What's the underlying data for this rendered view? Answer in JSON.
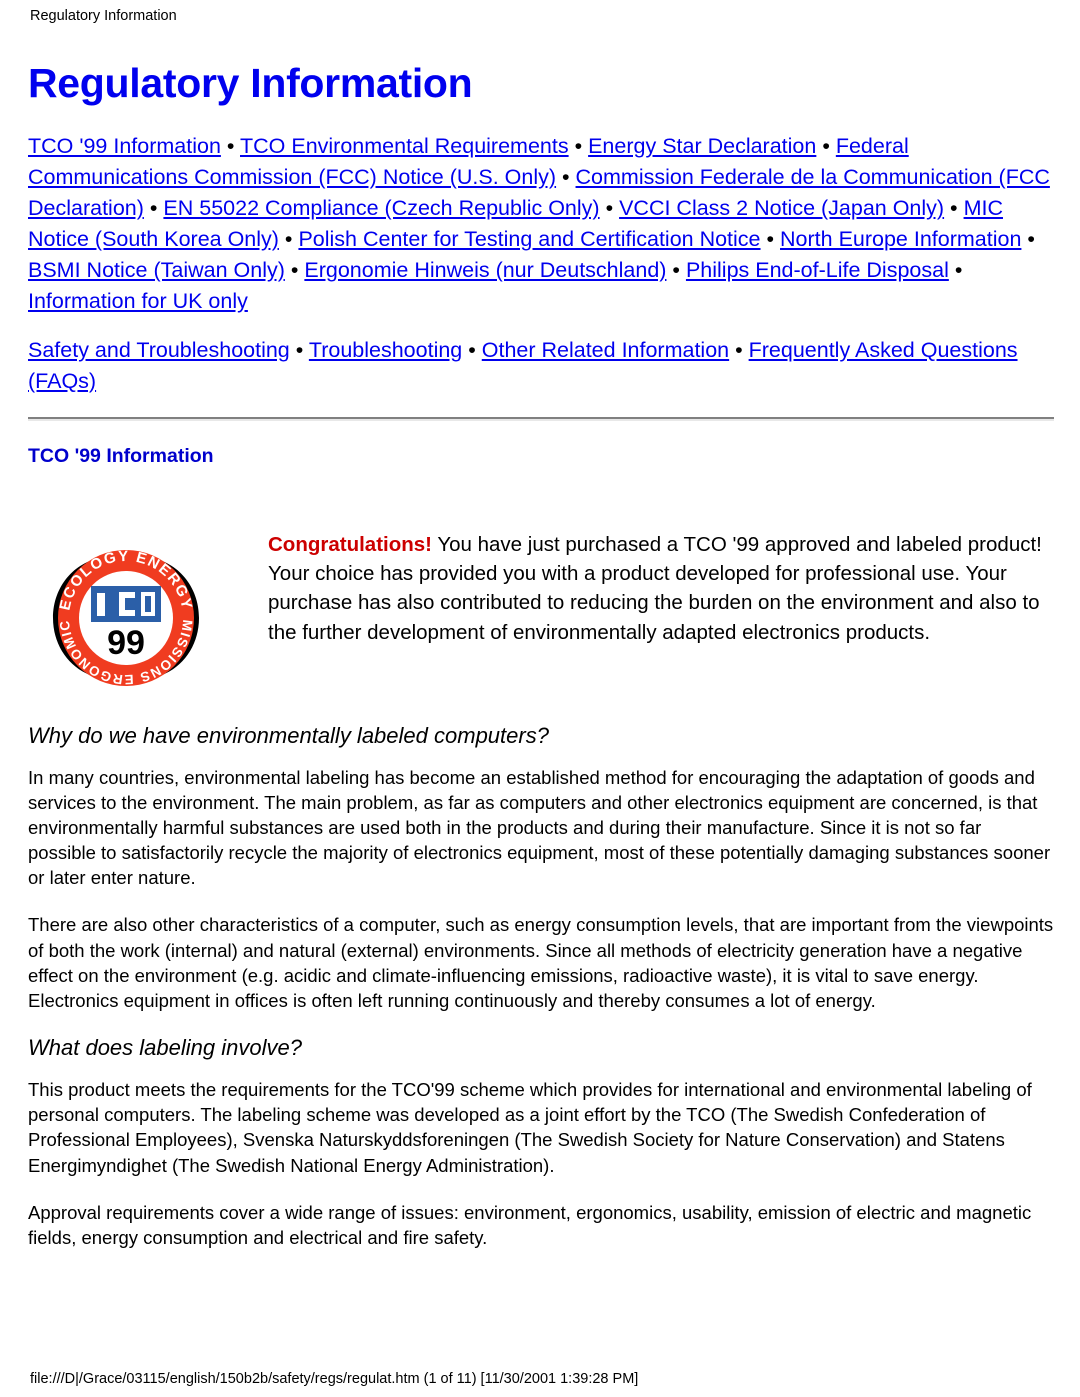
{
  "document": {
    "running_header": "Regulatory Information",
    "title": "Regulatory Information"
  },
  "nav": {
    "bullet": " • ",
    "group1": [
      "TCO '99 Information",
      "TCO Environmental Requirements",
      "Energy Star Declaration",
      "Federal Communications Commission (FCC) Notice (U.S. Only)",
      "Commission Federale de la Communication (FCC Declaration)",
      "EN 55022 Compliance (Czech Republic Only)",
      "VCCI Class 2 Notice (Japan Only)",
      "MIC Notice (South Korea Only)",
      "Polish Center for Testing and Certification Notice",
      "North Europe Information",
      "BSMI Notice (Taiwan Only)",
      "Ergonomie Hinweis (nur Deutschland)",
      "Philips End-of-Life Disposal",
      "Information for UK only"
    ],
    "group2": [
      "Safety and Troubleshooting",
      "Troubleshooting",
      "Other Related Information",
      "Frequently Asked Questions (FAQs)"
    ]
  },
  "section": {
    "heading": "TCO '99 Information",
    "logo": {
      "name": "tco-99-label",
      "top_text": "ECOLOGY ENERGY",
      "bottom_text": "EMISSIONS ERGONOMICS",
      "mark": "TCO",
      "year": "99",
      "ring_color": "#f03c20",
      "mark_color": "#2b5fa8",
      "year_color": "#000000"
    },
    "congratulations": {
      "lead": "Congratulations!",
      "lead_color": "#cc0000",
      "text": " You have just purchased a TCO '99 approved and labeled product! Your choice has provided you with a product developed for professional use. Your purchase has also contributed to reducing the burden on the environment and also to the further development of environmentally adapted electronics products."
    },
    "subsections": [
      {
        "heading": "Why do we have environmentally labeled computers?",
        "paragraphs": [
          "In many countries, environmental labeling has become an established method for encouraging the adaptation of goods and services to the environment. The main problem, as far as computers and other electronics equipment are concerned, is that environmentally harmful substances are used both in the products and during their manufacture. Since it is not so far possible to satisfactorily recycle the majority of electronics equipment, most of these potentially damaging substances sooner or later enter nature.",
          "There are also other characteristics of a computer, such as energy consumption levels, that are important from the viewpoints of both the work (internal) and natural (external) environments. Since all methods of electricity generation have a negative effect on the environment (e.g. acidic and climate-influencing emissions, radioactive waste), it is vital to save energy. Electronics equipment in offices is often left running continuously and thereby consumes a lot of energy."
        ]
      },
      {
        "heading": "What does labeling involve?",
        "paragraphs": [
          "This product meets the requirements for the TCO'99 scheme which provides for international and environmental labeling of personal computers. The labeling scheme was developed as a joint effort by the TCO (The Swedish Confederation of Professional Employees), Svenska Naturskyddsforeningen (The Swedish Society for Nature Conservation) and Statens Energimyndighet (The Swedish National Energy Administration).",
          "Approval requirements cover a wide range of issues: environment, ergonomics, usability, emission of electric and magnetic fields, energy consumption and electrical and fire safety."
        ]
      }
    ]
  },
  "footer": {
    "status": "file:///D|/Grace/03115/english/150b2b/safety/regs/regulat.htm (1 of 11) [11/30/2001 1:39:28 PM]"
  }
}
